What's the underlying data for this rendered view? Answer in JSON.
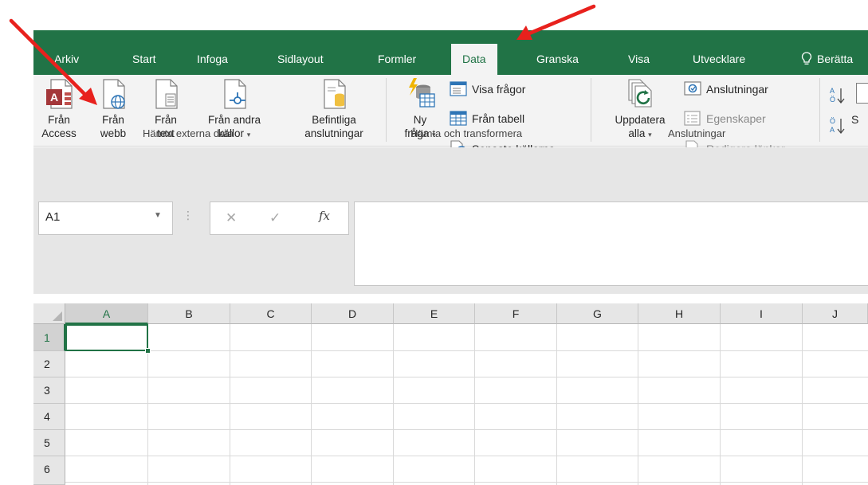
{
  "ribbon": {
    "tabs": [
      "Arkiv",
      "Start",
      "Infoga",
      "Sidlayout",
      "Formler",
      "Data",
      "Granska",
      "Visa",
      "Utvecklare"
    ],
    "active_tab": "Data",
    "tell_me": "Berätta",
    "groups": {
      "external": {
        "label": "Hämta externa data",
        "access": [
          "Från",
          "Access"
        ],
        "web": [
          "Från",
          "webb"
        ],
        "text": [
          "Från",
          "text"
        ],
        "other": [
          "Från andra",
          "källor"
        ],
        "existing": [
          "Befintliga",
          "anslutningar"
        ]
      },
      "transform": {
        "label": "Hämta och transformera",
        "new_query": [
          "Ny",
          "fråga"
        ],
        "show_queries": "Visa frågor",
        "from_table": "Från tabell",
        "recent_sources": "Senaste källorna"
      },
      "connections": {
        "label": "Anslutningar",
        "refresh": [
          "Uppdatera",
          "alla"
        ],
        "connections": "Anslutningar",
        "properties": "Egenskaper",
        "edit_links": "Redigera länkar"
      },
      "sort": {
        "partial_label": "S"
      }
    }
  },
  "formula_bar": {
    "name_box": "A1",
    "fx": "fx",
    "value": ""
  },
  "sheet": {
    "columns": [
      "A",
      "B",
      "C",
      "D",
      "E",
      "F",
      "G",
      "H",
      "I",
      "J"
    ],
    "rows": [
      "1",
      "2",
      "3",
      "4",
      "5",
      "6"
    ],
    "active_cell": "A1"
  },
  "colors": {
    "brand": "#217346",
    "arrow": "#e8211d"
  }
}
